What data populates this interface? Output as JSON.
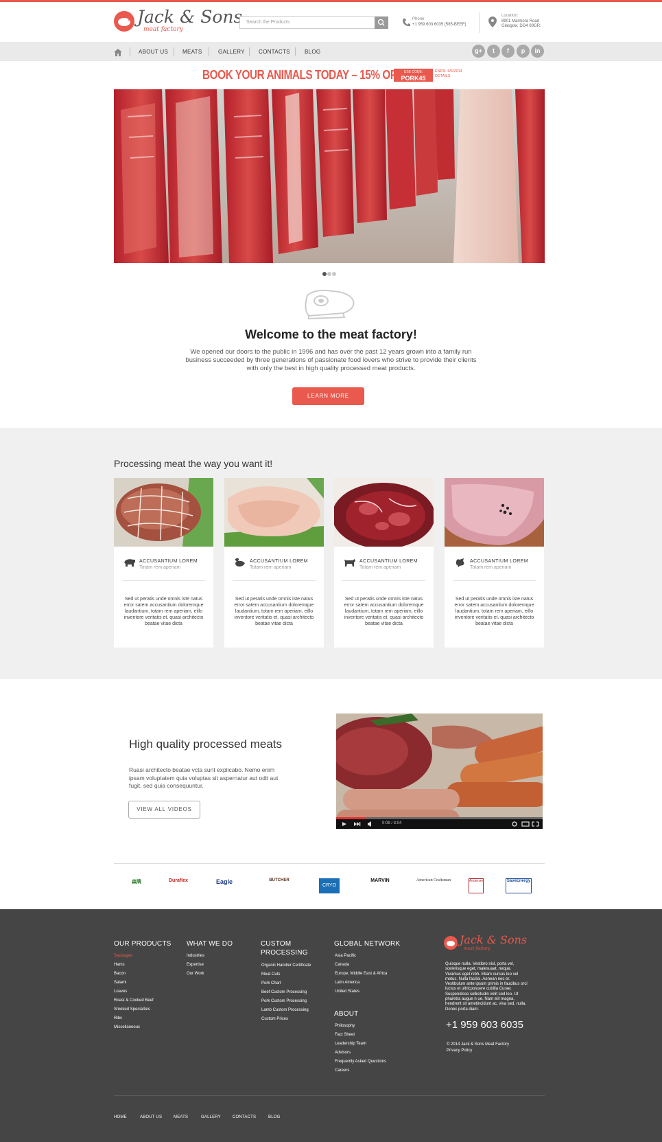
{
  "brand": {
    "name": "Jack & Sons",
    "tagline": "meat factory"
  },
  "search": {
    "placeholder": "Search the Products"
  },
  "contact": {
    "phone_label": "Phone:",
    "phone_value": "+1 959 603 6035 (585-BEEF)",
    "location_label": "Location:",
    "location_line1": "8901 Marmora Road",
    "location_line2": "Glasgow, DO4 89GR."
  },
  "nav": {
    "items": [
      "ABOUT US",
      "MEATS",
      "GALLERY",
      "CONTACTS",
      "BLOG"
    ]
  },
  "social": {
    "icons": [
      "google-plus-icon",
      "twitter-icon",
      "facebook-icon",
      "pinterest-icon",
      "linkedin-icon"
    ],
    "glyphs": [
      "g+",
      "t",
      "f",
      "p",
      "in"
    ]
  },
  "promo": {
    "headline": "BOOK YOUR ANIMALS TODAY – 15% OFF!",
    "code_label": "USE CODE:",
    "code": "PORK45",
    "ends": "ENDS: 5/6/2014",
    "details": "DETAILS"
  },
  "slider": {
    "dots": 3,
    "active": 0
  },
  "welcome": {
    "title": "Welcome to the meat factory!",
    "text": "We opened our doors to the public in 1996 and has over the past 12 years grown into a family run business succeeded by three generations of passionate food lovers who strive to provide their clients with only the best in high quality processed meat products.",
    "button": "LEARN MORE"
  },
  "processing": {
    "title": "Processing meat the way you want it!",
    "cards": [
      {
        "icon": "pig-icon",
        "title": "ACCUSANTIUM LOREM",
        "subtitle": "Totam rem aperiam",
        "text": "Sed ut peratis unde omnis iste natus error satem accusantium doloremque laudantium, totam rem aperiam, eillo inventore veritatis et. quasi architecto beatae vitae dicta"
      },
      {
        "icon": "duck-icon",
        "title": "ACCUSANTIUM LOREM",
        "subtitle": "Totam rem aperiam",
        "text": "Sed ut peratis unde omnis iste natus error satem accusantium doloremque laudantium, totam rem aperiam, eillo inventore veritatis et. quasi architecto beatae vitae dicta"
      },
      {
        "icon": "cow-icon",
        "title": "ACCUSANTIUM LOREM",
        "subtitle": "Totam rem aperiam",
        "text": "Sed ut peratis unde omnis iste natus error satem accusantium doloremque laudantium, totam rem aperiam, eillo inventore veritatis et. quasi architecto beatae vitae dicta"
      },
      {
        "icon": "chicken-icon",
        "title": "ACCUSANTIUM LOREM",
        "subtitle": "Totam rem aperiam",
        "text": "Sed ut peratis unde omnis iste natus error satem accusantium doloremque laudantium, totam rem aperiam, eillo inventore veritatis et. quasi architecto beatae vitae dicta"
      }
    ]
  },
  "quality": {
    "title": "High quality processed meats",
    "text": "Ruasi architecto beatae vcta sunt explicabo. Nemo enim ipsam voluptatem quia voluptas sit aspernatur aut odit aut fugit, sed quia consequuntur.",
    "button": "VIEW ALL VIDEOS",
    "video_time": "0:09 / 3:04"
  },
  "brands": [
    "森牌",
    "Duraflex",
    "Eagle",
    "BUTCHER",
    "CRYO",
    "MARVIN",
    "American Craftsman",
    "Andersen",
    "SaveEnergy"
  ],
  "footer": {
    "products": {
      "title": "OUR PRODUCTS",
      "items": [
        "Sausages",
        "Hams",
        "Bacon",
        "Salami",
        "Loaves",
        "Roast & Cooked Beef",
        "Smoked Specialties",
        "Ribs",
        "Miscellaneous"
      ]
    },
    "whatwedo": {
      "title": "WHAT WE DO",
      "items": [
        "Industries",
        "Expertise",
        "Our Work"
      ]
    },
    "custom": {
      "title_l1": "CUSTOM",
      "title_l2": "PROCESSING",
      "items": [
        "Organic Handler Certificate",
        "Meat Cuts",
        "Pork Chart",
        "Beef Custom Processing",
        "Pork Custom Processing",
        "Lamb Custom Processing",
        "Custom Prices"
      ]
    },
    "global": {
      "title": "GLOBAL NETWORK",
      "items": [
        "Asia Pacific",
        "Canada",
        "Europe, Middle East & Africa",
        "Latin America",
        "United States"
      ]
    },
    "about": {
      "title": "ABOUT",
      "items": [
        "Philosophy",
        "Fact Sheet",
        "Leadership Team",
        "Advisors",
        "Frequently Asked Questions",
        "Careers"
      ]
    },
    "about_text": "Quisque nulla. Vestibro nisl, porta vel, scelerisque eget, malesuaat, neque. Vivamus eget nibh. Etiam cursus leo vel metus. Nulla facilisi. Aenean nec er. Vestibulum ante ipsum primis in faucibus orci luctus et ultricposuere cubilia Curae; Suspendisse sollicitudin velit sed leo. Ut pharetra augue n ue. Nam elit magna, hendrerit sit ametincidunt ac, viva sed, nulla. Donec porta diam.",
    "phone": "+1 959 603 6035",
    "copyright": "© 2014 Jack & Sons Meat Factory",
    "privacy": "Privacy Policy",
    "nav": [
      "HOME",
      "ABOUT US",
      "MEATS",
      "GALLERY",
      "CONTACTS",
      "BLOG"
    ]
  },
  "colors": {
    "accent": "#e9594d",
    "footer_bg": "#454545",
    "section_bg": "#eff0ef"
  }
}
